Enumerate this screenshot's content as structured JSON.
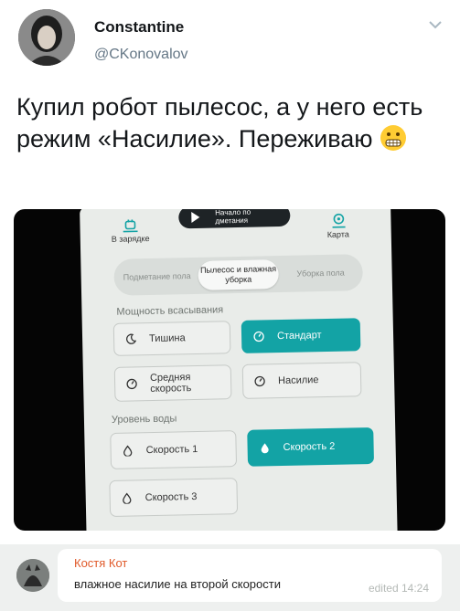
{
  "tweet": {
    "author_name": "Constantine",
    "author_handle": "@CKonovalov",
    "text": "Купил робот пылесос, а у него есть режим «Насилие». Переживаю",
    "emoji": "grimacing-face"
  },
  "photo": {
    "play_label": "Начало по дметания",
    "dock_label": "В зарядке",
    "map_label": "Карта",
    "modes": [
      {
        "label": "Подметание пола",
        "active": false
      },
      {
        "label": "Пылесос и влажная уборка",
        "active": true
      },
      {
        "label": "Уборка пола",
        "active": false
      }
    ],
    "suction_title": "Мощность всасывания",
    "suction": [
      {
        "label": "Тишина",
        "icon": "moon-icon",
        "active": false
      },
      {
        "label": "Стандарт",
        "icon": "gauge-icon",
        "active": true
      },
      {
        "label": "Средняя скорость",
        "icon": "gauge-icon",
        "active": false
      },
      {
        "label": "Насилие",
        "icon": "gauge-icon",
        "active": false
      }
    ],
    "water_title": "Уровень воды",
    "water": [
      {
        "label": "Скорость 1",
        "icon": "drop-icon",
        "active": false
      },
      {
        "label": "Скорость 2",
        "icon": "drop-icon",
        "active": true
      },
      {
        "label": "Скорость 3",
        "icon": "drop-icon",
        "active": false
      }
    ],
    "accent_color": "#13a3a5"
  },
  "comment": {
    "author": "Костя Кот",
    "text": "влажное насилие на второй скорости",
    "edited": "edited 14:24",
    "name_color": "#e05a2a"
  }
}
